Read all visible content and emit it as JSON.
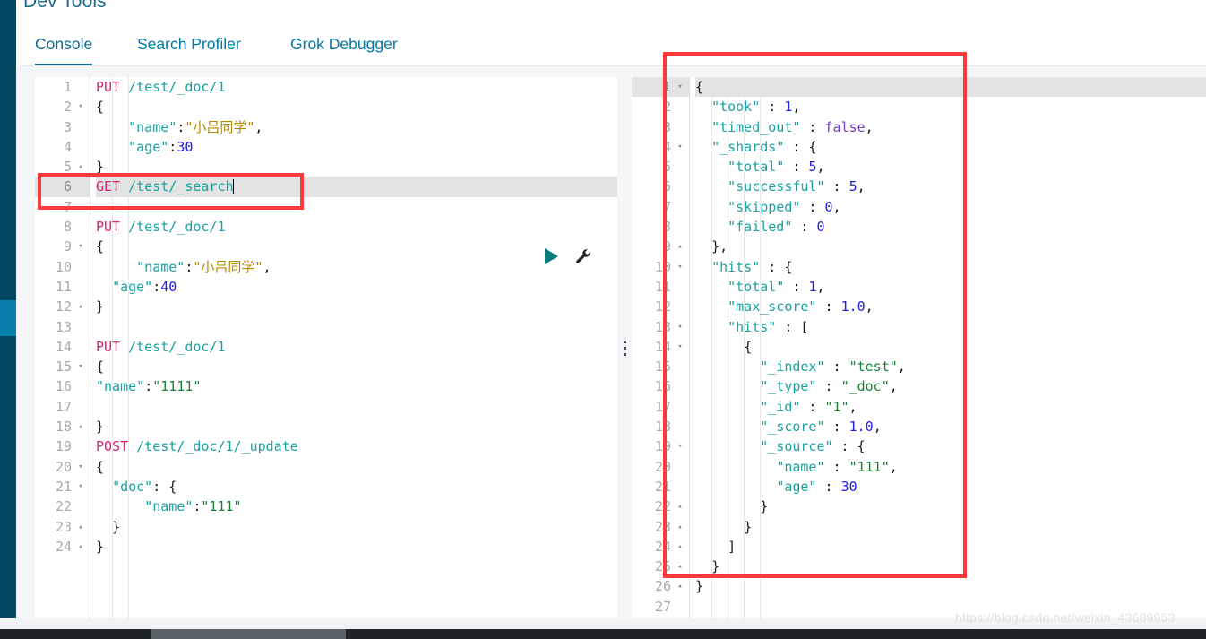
{
  "app": {
    "title": "Dev Tools",
    "brand_color": "#014a62",
    "accent_color": "#0079a5",
    "annotation_color": "#fa3b3b"
  },
  "tabs": [
    {
      "label": "Console",
      "active": true
    },
    {
      "label": "Search Profiler",
      "active": false
    },
    {
      "label": "Grok Debugger",
      "active": false
    }
  ],
  "toolbar": {
    "play_label": "Click to send request",
    "wrench_label": "Open documentation / settings"
  },
  "request_editor": {
    "name": "console-request-editor",
    "highlighted_line": 6,
    "cursor_line": 6,
    "lines": [
      {
        "n": 1,
        "fold": "",
        "tokens": [
          {
            "c": "t-method",
            "t": "PUT"
          },
          {
            "c": "t-plain",
            "t": " "
          },
          {
            "c": "t-url",
            "t": "/test/_doc/1"
          }
        ]
      },
      {
        "n": 2,
        "fold": "▾",
        "tokens": [
          {
            "c": "t-brace",
            "t": "{"
          }
        ]
      },
      {
        "n": 3,
        "fold": "",
        "tokens": [
          {
            "c": "t-plain",
            "t": "    "
          },
          {
            "c": "t-key",
            "t": "\"name\""
          },
          {
            "c": "t-punc",
            "t": ":"
          },
          {
            "c": "t-cjk",
            "t": "\"小吕同学\""
          },
          {
            "c": "t-punc",
            "t": ","
          }
        ]
      },
      {
        "n": 4,
        "fold": "",
        "tokens": [
          {
            "c": "t-plain",
            "t": "    "
          },
          {
            "c": "t-key",
            "t": "\"age\""
          },
          {
            "c": "t-punc",
            "t": ":"
          },
          {
            "c": "t-num",
            "t": "30"
          }
        ]
      },
      {
        "n": 5,
        "fold": "▴",
        "tokens": [
          {
            "c": "t-brace",
            "t": "}"
          }
        ]
      },
      {
        "n": 6,
        "fold": "",
        "tokens": [
          {
            "c": "t-method",
            "t": "GET"
          },
          {
            "c": "t-plain",
            "t": " "
          },
          {
            "c": "t-url",
            "t": "/test/_search"
          }
        ]
      },
      {
        "n": 7,
        "fold": "",
        "tokens": []
      },
      {
        "n": 8,
        "fold": "",
        "tokens": [
          {
            "c": "t-method",
            "t": "PUT"
          },
          {
            "c": "t-plain",
            "t": " "
          },
          {
            "c": "t-url",
            "t": "/test/_doc/1"
          }
        ]
      },
      {
        "n": 9,
        "fold": "▾",
        "tokens": [
          {
            "c": "t-brace",
            "t": "{"
          }
        ]
      },
      {
        "n": 10,
        "fold": "",
        "tokens": [
          {
            "c": "t-plain",
            "t": "     "
          },
          {
            "c": "t-key",
            "t": "\"name\""
          },
          {
            "c": "t-punc",
            "t": ":"
          },
          {
            "c": "t-cjk",
            "t": "\"小吕同学\""
          },
          {
            "c": "t-punc",
            "t": ","
          }
        ]
      },
      {
        "n": 11,
        "fold": "",
        "tokens": [
          {
            "c": "t-plain",
            "t": "  "
          },
          {
            "c": "t-key",
            "t": "\"age\""
          },
          {
            "c": "t-punc",
            "t": ":"
          },
          {
            "c": "t-num",
            "t": "40"
          }
        ]
      },
      {
        "n": 12,
        "fold": "▴",
        "tokens": [
          {
            "c": "t-brace",
            "t": "}"
          }
        ]
      },
      {
        "n": 13,
        "fold": "",
        "tokens": []
      },
      {
        "n": 14,
        "fold": "",
        "tokens": [
          {
            "c": "t-method",
            "t": "PUT"
          },
          {
            "c": "t-plain",
            "t": " "
          },
          {
            "c": "t-url",
            "t": "/test/_doc/1"
          }
        ]
      },
      {
        "n": 15,
        "fold": "▾",
        "tokens": [
          {
            "c": "t-brace",
            "t": "{"
          }
        ]
      },
      {
        "n": 16,
        "fold": "",
        "tokens": [
          {
            "c": "t-key",
            "t": "\"name\""
          },
          {
            "c": "t-punc",
            "t": ":"
          },
          {
            "c": "t-str",
            "t": "\"1111\""
          }
        ]
      },
      {
        "n": 17,
        "fold": "",
        "tokens": []
      },
      {
        "n": 18,
        "fold": "▴",
        "tokens": [
          {
            "c": "t-brace",
            "t": "}"
          }
        ]
      },
      {
        "n": 19,
        "fold": "",
        "tokens": [
          {
            "c": "t-method",
            "t": "POST"
          },
          {
            "c": "t-plain",
            "t": " "
          },
          {
            "c": "t-url",
            "t": "/test/_doc/1/_update"
          }
        ]
      },
      {
        "n": 20,
        "fold": "▾",
        "tokens": [
          {
            "c": "t-brace",
            "t": "{"
          }
        ]
      },
      {
        "n": 21,
        "fold": "▾",
        "tokens": [
          {
            "c": "t-plain",
            "t": "  "
          },
          {
            "c": "t-key",
            "t": "\"doc\""
          },
          {
            "c": "t-punc",
            "t": ": "
          },
          {
            "c": "t-brace",
            "t": "{"
          }
        ]
      },
      {
        "n": 22,
        "fold": "",
        "tokens": [
          {
            "c": "t-plain",
            "t": "      "
          },
          {
            "c": "t-key",
            "t": "\"name\""
          },
          {
            "c": "t-punc",
            "t": ":"
          },
          {
            "c": "t-str",
            "t": "\"111\""
          }
        ]
      },
      {
        "n": 23,
        "fold": "▴",
        "tokens": [
          {
            "c": "t-plain",
            "t": "  "
          },
          {
            "c": "t-brace",
            "t": "}"
          }
        ]
      },
      {
        "n": 24,
        "fold": "▴",
        "tokens": [
          {
            "c": "t-brace",
            "t": "}"
          }
        ]
      }
    ]
  },
  "response_editor": {
    "name": "console-response-viewer",
    "highlighted_line": 1,
    "lines": [
      {
        "n": 1,
        "fold": "▾",
        "tokens": [
          {
            "c": "t-brace",
            "t": "{"
          }
        ]
      },
      {
        "n": 2,
        "fold": "",
        "tokens": [
          {
            "c": "t-plain",
            "t": "  "
          },
          {
            "c": "t-key",
            "t": "\"took\""
          },
          {
            "c": "t-punc",
            "t": " : "
          },
          {
            "c": "t-num",
            "t": "1"
          },
          {
            "c": "t-punc",
            "t": ","
          }
        ]
      },
      {
        "n": 3,
        "fold": "",
        "tokens": [
          {
            "c": "t-plain",
            "t": "  "
          },
          {
            "c": "t-key",
            "t": "\"timed_out\""
          },
          {
            "c": "t-punc",
            "t": " : "
          },
          {
            "c": "t-bool",
            "t": "false"
          },
          {
            "c": "t-punc",
            "t": ","
          }
        ]
      },
      {
        "n": 4,
        "fold": "▾",
        "tokens": [
          {
            "c": "t-plain",
            "t": "  "
          },
          {
            "c": "t-key",
            "t": "\"_shards\""
          },
          {
            "c": "t-punc",
            "t": " : "
          },
          {
            "c": "t-brace",
            "t": "{"
          }
        ]
      },
      {
        "n": 5,
        "fold": "",
        "tokens": [
          {
            "c": "t-plain",
            "t": "    "
          },
          {
            "c": "t-key",
            "t": "\"total\""
          },
          {
            "c": "t-punc",
            "t": " : "
          },
          {
            "c": "t-num",
            "t": "5"
          },
          {
            "c": "t-punc",
            "t": ","
          }
        ]
      },
      {
        "n": 6,
        "fold": "",
        "tokens": [
          {
            "c": "t-plain",
            "t": "    "
          },
          {
            "c": "t-key",
            "t": "\"successful\""
          },
          {
            "c": "t-punc",
            "t": " : "
          },
          {
            "c": "t-num",
            "t": "5"
          },
          {
            "c": "t-punc",
            "t": ","
          }
        ]
      },
      {
        "n": 7,
        "fold": "",
        "tokens": [
          {
            "c": "t-plain",
            "t": "    "
          },
          {
            "c": "t-key",
            "t": "\"skipped\""
          },
          {
            "c": "t-punc",
            "t": " : "
          },
          {
            "c": "t-num",
            "t": "0"
          },
          {
            "c": "t-punc",
            "t": ","
          }
        ]
      },
      {
        "n": 8,
        "fold": "",
        "tokens": [
          {
            "c": "t-plain",
            "t": "    "
          },
          {
            "c": "t-key",
            "t": "\"failed\""
          },
          {
            "c": "t-punc",
            "t": " : "
          },
          {
            "c": "t-num",
            "t": "0"
          }
        ]
      },
      {
        "n": 9,
        "fold": "▴",
        "tokens": [
          {
            "c": "t-plain",
            "t": "  "
          },
          {
            "c": "t-brace",
            "t": "}"
          },
          {
            "c": "t-punc",
            "t": ","
          }
        ]
      },
      {
        "n": 10,
        "fold": "▾",
        "tokens": [
          {
            "c": "t-plain",
            "t": "  "
          },
          {
            "c": "t-key",
            "t": "\"hits\""
          },
          {
            "c": "t-punc",
            "t": " : "
          },
          {
            "c": "t-brace",
            "t": "{"
          }
        ]
      },
      {
        "n": 11,
        "fold": "",
        "tokens": [
          {
            "c": "t-plain",
            "t": "    "
          },
          {
            "c": "t-key",
            "t": "\"total\""
          },
          {
            "c": "t-punc",
            "t": " : "
          },
          {
            "c": "t-num",
            "t": "1"
          },
          {
            "c": "t-punc",
            "t": ","
          }
        ]
      },
      {
        "n": 12,
        "fold": "",
        "tokens": [
          {
            "c": "t-plain",
            "t": "    "
          },
          {
            "c": "t-key",
            "t": "\"max_score\""
          },
          {
            "c": "t-punc",
            "t": " : "
          },
          {
            "c": "t-num",
            "t": "1.0"
          },
          {
            "c": "t-punc",
            "t": ","
          }
        ]
      },
      {
        "n": 13,
        "fold": "▾",
        "tokens": [
          {
            "c": "t-plain",
            "t": "    "
          },
          {
            "c": "t-key",
            "t": "\"hits\""
          },
          {
            "c": "t-punc",
            "t": " : "
          },
          {
            "c": "t-brace",
            "t": "["
          }
        ]
      },
      {
        "n": 14,
        "fold": "▾",
        "tokens": [
          {
            "c": "t-plain",
            "t": "      "
          },
          {
            "c": "t-brace",
            "t": "{"
          }
        ]
      },
      {
        "n": 15,
        "fold": "",
        "tokens": [
          {
            "c": "t-plain",
            "t": "        "
          },
          {
            "c": "t-key",
            "t": "\"_index\""
          },
          {
            "c": "t-punc",
            "t": " : "
          },
          {
            "c": "t-str",
            "t": "\"test\""
          },
          {
            "c": "t-punc",
            "t": ","
          }
        ]
      },
      {
        "n": 16,
        "fold": "",
        "tokens": [
          {
            "c": "t-plain",
            "t": "        "
          },
          {
            "c": "t-key",
            "t": "\"_type\""
          },
          {
            "c": "t-punc",
            "t": " : "
          },
          {
            "c": "t-str",
            "t": "\"_doc\""
          },
          {
            "c": "t-punc",
            "t": ","
          }
        ]
      },
      {
        "n": 17,
        "fold": "",
        "tokens": [
          {
            "c": "t-plain",
            "t": "        "
          },
          {
            "c": "t-key",
            "t": "\"_id\""
          },
          {
            "c": "t-punc",
            "t": " : "
          },
          {
            "c": "t-str",
            "t": "\"1\""
          },
          {
            "c": "t-punc",
            "t": ","
          }
        ]
      },
      {
        "n": 18,
        "fold": "",
        "tokens": [
          {
            "c": "t-plain",
            "t": "        "
          },
          {
            "c": "t-key",
            "t": "\"_score\""
          },
          {
            "c": "t-punc",
            "t": " : "
          },
          {
            "c": "t-num",
            "t": "1.0"
          },
          {
            "c": "t-punc",
            "t": ","
          }
        ]
      },
      {
        "n": 19,
        "fold": "▾",
        "tokens": [
          {
            "c": "t-plain",
            "t": "        "
          },
          {
            "c": "t-key",
            "t": "\"_source\""
          },
          {
            "c": "t-punc",
            "t": " : "
          },
          {
            "c": "t-brace",
            "t": "{"
          }
        ]
      },
      {
        "n": 20,
        "fold": "",
        "tokens": [
          {
            "c": "t-plain",
            "t": "          "
          },
          {
            "c": "t-key",
            "t": "\"name\""
          },
          {
            "c": "t-punc",
            "t": " : "
          },
          {
            "c": "t-str",
            "t": "\"111\""
          },
          {
            "c": "t-punc",
            "t": ","
          }
        ]
      },
      {
        "n": 21,
        "fold": "",
        "tokens": [
          {
            "c": "t-plain",
            "t": "          "
          },
          {
            "c": "t-key",
            "t": "\"age\""
          },
          {
            "c": "t-punc",
            "t": " : "
          },
          {
            "c": "t-num",
            "t": "30"
          }
        ]
      },
      {
        "n": 22,
        "fold": "▴",
        "tokens": [
          {
            "c": "t-plain",
            "t": "        "
          },
          {
            "c": "t-brace",
            "t": "}"
          }
        ]
      },
      {
        "n": 23,
        "fold": "▴",
        "tokens": [
          {
            "c": "t-plain",
            "t": "      "
          },
          {
            "c": "t-brace",
            "t": "}"
          }
        ]
      },
      {
        "n": 24,
        "fold": "▴",
        "tokens": [
          {
            "c": "t-plain",
            "t": "    "
          },
          {
            "c": "t-brace",
            "t": "]"
          }
        ]
      },
      {
        "n": 25,
        "fold": "▴",
        "tokens": [
          {
            "c": "t-plain",
            "t": "  "
          },
          {
            "c": "t-brace",
            "t": "}"
          }
        ]
      },
      {
        "n": 26,
        "fold": "▴",
        "tokens": [
          {
            "c": "t-brace",
            "t": "}"
          }
        ]
      },
      {
        "n": 27,
        "fold": "",
        "tokens": []
      }
    ]
  },
  "annotations": [
    {
      "name": "redbox-request-line",
      "target": "GET /test/_search"
    },
    {
      "name": "redbox-response-body",
      "target": "search response JSON"
    }
  ],
  "watermark": {
    "text": "https://blog.csdn.net/weixin_43689953"
  }
}
